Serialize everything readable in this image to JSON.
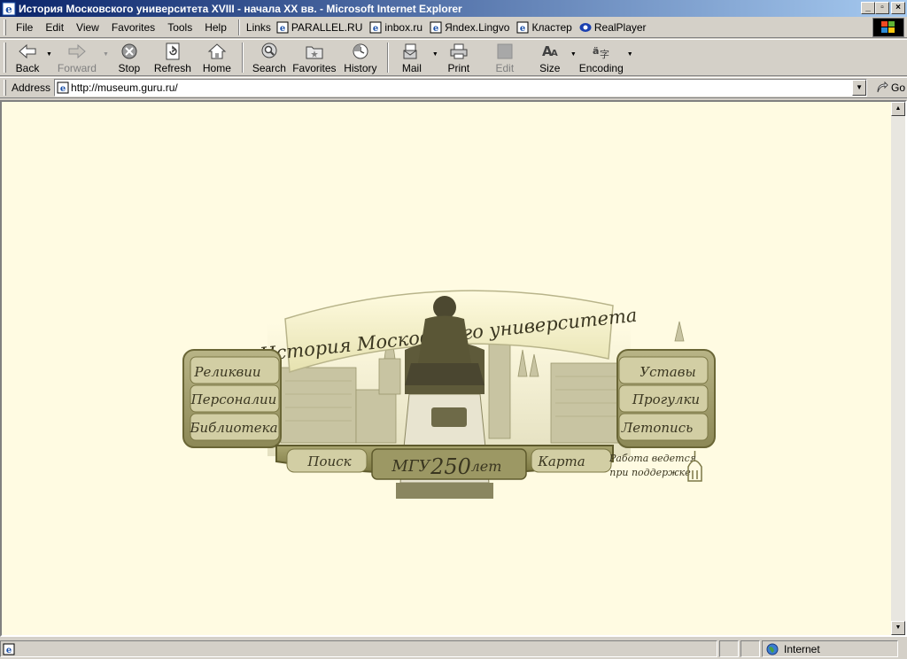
{
  "window": {
    "title": "История Московского университета XVIII - начала XX вв. - Microsoft Internet Explorer",
    "buttons": {
      "minimize": "_",
      "maximize": "▫",
      "close": "×"
    }
  },
  "menu": {
    "items": [
      "File",
      "Edit",
      "View",
      "Favorites",
      "Tools",
      "Help"
    ],
    "links_label": "Links",
    "links": [
      "PARALLEL.RU",
      "inbox.ru",
      "Яndex.Lingvo",
      "Кластер",
      "RealPlayer"
    ]
  },
  "toolbar": {
    "back": "Back",
    "forward": "Forward",
    "stop": "Stop",
    "refresh": "Refresh",
    "home": "Home",
    "search": "Search",
    "favorites": "Favorites",
    "history": "History",
    "mail": "Mail",
    "print": "Print",
    "edit": "Edit",
    "size": "Size",
    "encoding": "Encoding"
  },
  "address": {
    "label": "Address",
    "url": "http://museum.guru.ru/",
    "go": "Go"
  },
  "site": {
    "banner": "История Московского университета",
    "nav_left": [
      "Реликвии",
      "Персоналии",
      "Библиотека"
    ],
    "nav_right": [
      "Уставы",
      "Прогулки",
      "Летопись"
    ],
    "search": "Поиск",
    "map": "Карта",
    "center_badge_a": "МГУ",
    "center_badge_b": "250",
    "center_badge_c": "лет",
    "support_line1": "Работа ведется",
    "support_line2": "при поддержке",
    "colors": {
      "page_bg": "#fffbe2",
      "olive": "#8a8650",
      "olive_dark": "#5e5a2c"
    }
  },
  "status": {
    "zone": "Internet"
  }
}
